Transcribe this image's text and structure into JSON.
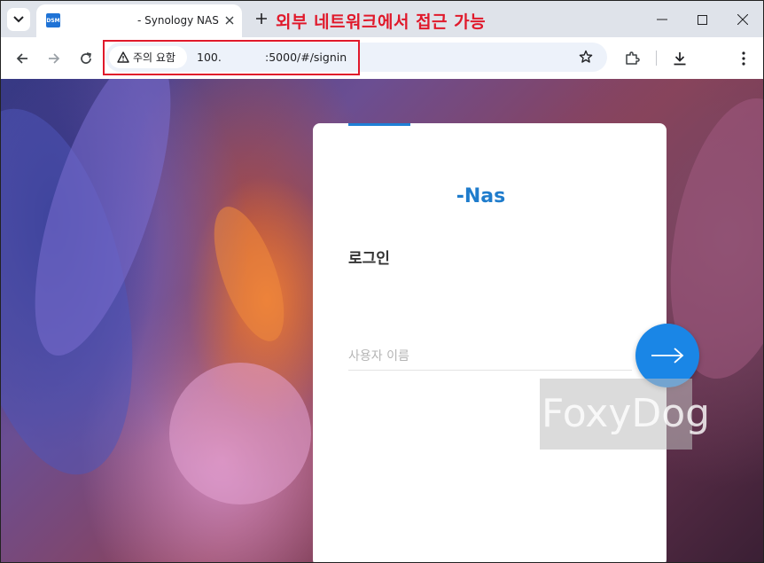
{
  "browser": {
    "tab": {
      "favicon_label": "DSM",
      "title": "- Synology NAS"
    },
    "annotation": "외부 네트워크에서 접근 가능",
    "address_bar": {
      "security_chip": "주의 요함",
      "url_host": "100.",
      "url_path": ":5000/#/signin"
    }
  },
  "login": {
    "brand": "-Nas",
    "title": "로그인",
    "username_placeholder": "사용자 이름"
  },
  "watermark": "FoxyDog",
  "colors": {
    "accent": "#1f80d6",
    "submit_button": "#1a86e6",
    "annotation_red": "#e0192b"
  }
}
